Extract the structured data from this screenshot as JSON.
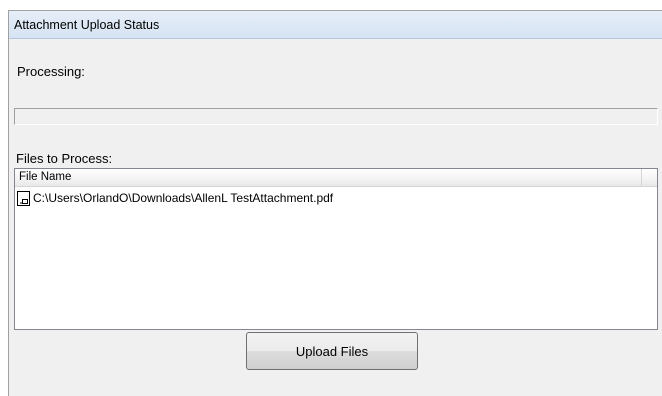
{
  "window": {
    "title": "Attachment Upload Status"
  },
  "processing": {
    "label": "Processing:",
    "progress": 0
  },
  "files": {
    "label": "Files to Process:",
    "columns": [
      "File Name"
    ],
    "items": [
      {
        "icon": "file-icon",
        "name": "C:\\Users\\OrlandO\\Downloads\\AllenL TestAttachment.pdf"
      }
    ]
  },
  "actions": {
    "upload_label": "Upload Files"
  }
}
